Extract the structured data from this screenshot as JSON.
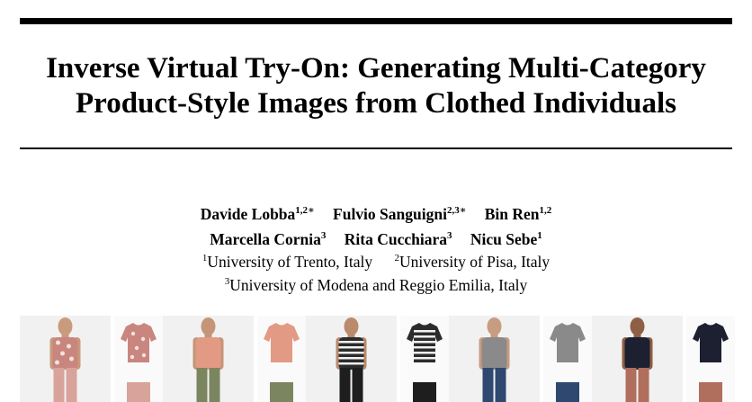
{
  "paper": {
    "title_line1": "Inverse Virtual Try-On: Generating Multi-Category",
    "title_line2": "Product-Style Images from Clothed Individuals",
    "authors_row1": [
      {
        "name": "Davide Lobba",
        "sup": "1,2∗"
      },
      {
        "name": "Fulvio Sanguigni",
        "sup": "2,3∗"
      },
      {
        "name": "Bin Ren",
        "sup": "1,2"
      }
    ],
    "authors_row2": [
      {
        "name": "Marcella Cornia",
        "sup": "3"
      },
      {
        "name": "Rita Cucchiara",
        "sup": "3"
      },
      {
        "name": "Nicu Sebe",
        "sup": "1"
      }
    ],
    "affiliations_row1": [
      {
        "sup": "1",
        "text": "University of Trento, Italy"
      },
      {
        "sup": "2",
        "text": "University of Pisa, Italy"
      }
    ],
    "affiliations_row2": [
      {
        "sup": "3",
        "text": "University of Modena and Reggio Emilia, Italy"
      }
    ]
  },
  "figure": {
    "pairs": [
      {
        "top_color": "#c9867f",
        "bottom_color": "#d8a39b",
        "skin": "#c99a7c",
        "top_pattern": "floral"
      },
      {
        "top_color": "#e39a84",
        "bottom_color": "#7b8560",
        "skin": "#c49578",
        "top_pattern": "solid"
      },
      {
        "top_color": "#2c2c2c",
        "bottom_color": "#1e1e1e",
        "skin": "#b98a6b",
        "top_pattern": "stripes"
      },
      {
        "top_color": "#8a8a8a",
        "bottom_color": "#2e4870",
        "skin": "#c79c80",
        "top_pattern": "solid"
      },
      {
        "top_color": "#1c2030",
        "bottom_color": "#b06e5c",
        "skin": "#8d5f45",
        "top_pattern": "solid"
      }
    ]
  }
}
